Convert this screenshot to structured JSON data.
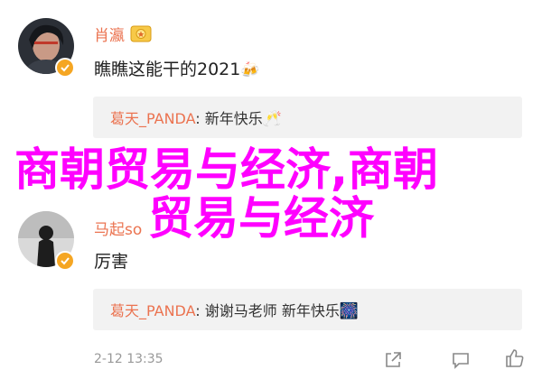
{
  "comments": [
    {
      "username": "肖瀛",
      "text": "瞧瞧这能干的2021",
      "text_emoji": "🍻",
      "reply": {
        "name": "葛天_PANDA",
        "sep": ": ",
        "text": "新年快乐",
        "emoji": "🥂"
      }
    },
    {
      "username": "马起so",
      "text": "厉害",
      "reply": {
        "name": "葛天_PANDA",
        "sep": ": ",
        "text": "谢谢马老师 新年快乐",
        "emoji": "🎆"
      },
      "timestamp": "2-12 13:35"
    }
  ],
  "overlay": {
    "line1": "商朝贸易与经济,商朝",
    "line2": "贸易与经济"
  },
  "colors": {
    "username": "#eb7350",
    "overlay": "#ff00ff",
    "verified_badge": "#f5a623"
  },
  "icons": [
    "verified-badge-icon",
    "medal-icon",
    "share-icon",
    "comment-icon",
    "like-icon"
  ]
}
